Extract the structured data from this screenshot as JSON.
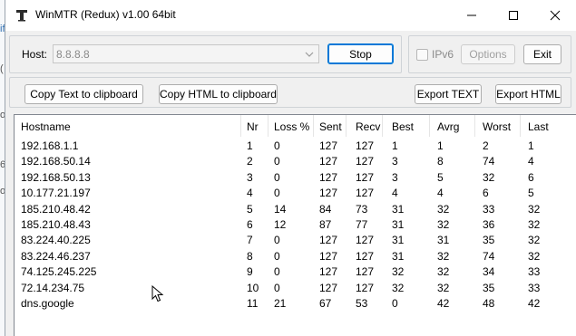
{
  "window": {
    "title": "WinMTR (Redux) v1.00 64bit",
    "minimize_icon": "minimize-icon",
    "maximize_icon": "maximize-icon",
    "close_icon": "close-icon"
  },
  "toolbar": {
    "host_label": "Host:",
    "host_value": "8.8.8.8",
    "stop_label": "Stop",
    "ipv6_label": "IPv6",
    "ipv6_checked": false,
    "options_label": "Options",
    "exit_label": "Exit",
    "copy_text_label": "Copy Text to clipboard",
    "copy_html_label": "Copy HTML to clipboard",
    "export_text_label": "Export TEXT",
    "export_html_label": "Export HTML"
  },
  "table": {
    "columns": [
      "Hostname",
      "Nr",
      "Loss %",
      "Sent",
      "Recv",
      "Best",
      "Avrg",
      "Worst",
      "Last"
    ],
    "rows": [
      [
        "192.168.1.1",
        "1",
        "0",
        "127",
        "127",
        "1",
        "1",
        "2",
        "1"
      ],
      [
        "192.168.50.14",
        "2",
        "0",
        "127",
        "127",
        "3",
        "8",
        "74",
        "4"
      ],
      [
        "192.168.50.13",
        "3",
        "0",
        "127",
        "127",
        "3",
        "5",
        "32",
        "6"
      ],
      [
        "10.177.21.197",
        "4",
        "0",
        "127",
        "127",
        "4",
        "4",
        "6",
        "5"
      ],
      [
        "185.210.48.42",
        "5",
        "14",
        "84",
        "73",
        "31",
        "32",
        "33",
        "32"
      ],
      [
        "185.210.48.43",
        "6",
        "12",
        "87",
        "77",
        "31",
        "32",
        "36",
        "32"
      ],
      [
        "83.224.40.225",
        "7",
        "0",
        "127",
        "127",
        "31",
        "31",
        "35",
        "32"
      ],
      [
        "83.224.46.237",
        "8",
        "0",
        "127",
        "127",
        "31",
        "32",
        "74",
        "32"
      ],
      [
        "74.125.245.225",
        "9",
        "0",
        "127",
        "127",
        "32",
        "32",
        "34",
        "33"
      ],
      [
        "72.14.234.75",
        "10",
        "0",
        "127",
        "127",
        "32",
        "32",
        "35",
        "33"
      ],
      [
        "dns.google",
        "11",
        "21",
        "67",
        "53",
        "0",
        "42",
        "48",
        "42"
      ]
    ]
  },
  "background": {
    "chars": [
      "if",
      "(",
      "ol",
      "6",
      "o"
    ]
  },
  "colors": {
    "accent": "#0078d7",
    "window_bg": "#f0f0f0",
    "title_bg": "#ffffff"
  }
}
